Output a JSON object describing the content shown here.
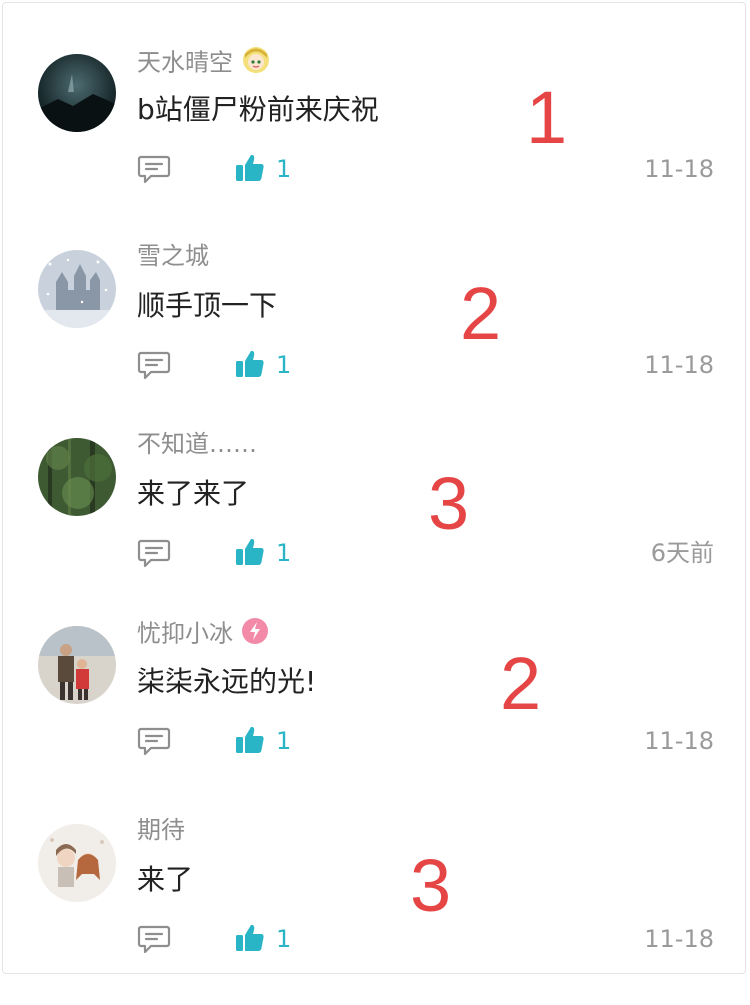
{
  "colors": {
    "accent_like": "#2ab5c6",
    "annotation_red": "#e64545",
    "username_gray": "#8e8e8e",
    "time_gray": "#9a9a9a",
    "text_dark": "#222222"
  },
  "comments": [
    {
      "username": "天水晴空",
      "has_badge": true,
      "badge_icon": "anime-girl-badge-icon",
      "content": "b站僵尸粉前来庆祝",
      "likes": "1",
      "time": "11-18",
      "annotation": "1",
      "avatar_icon": "dark-night-scene-avatar"
    },
    {
      "username": "雪之城",
      "has_badge": false,
      "content": "顺手顶一下",
      "likes": "1",
      "time": "11-18",
      "annotation": "2",
      "avatar_icon": "snowy-castle-avatar"
    },
    {
      "username": "不知道……",
      "has_badge": false,
      "content": "来了来了",
      "likes": "1",
      "time": "6天前",
      "annotation": "3",
      "avatar_icon": "forest-avatar"
    },
    {
      "username": "忧抑小冰",
      "has_badge": true,
      "badge_icon": "pink-lightning-badge-icon",
      "content": "柒柒永远的光!",
      "likes": "1",
      "time": "11-18",
      "annotation": "2",
      "avatar_icon": "family-photo-avatar"
    },
    {
      "username": "期待",
      "has_badge": false,
      "content": "来了",
      "likes": "1",
      "time": "11-18",
      "annotation": "3",
      "avatar_icon": "couple-illustration-avatar"
    }
  ]
}
